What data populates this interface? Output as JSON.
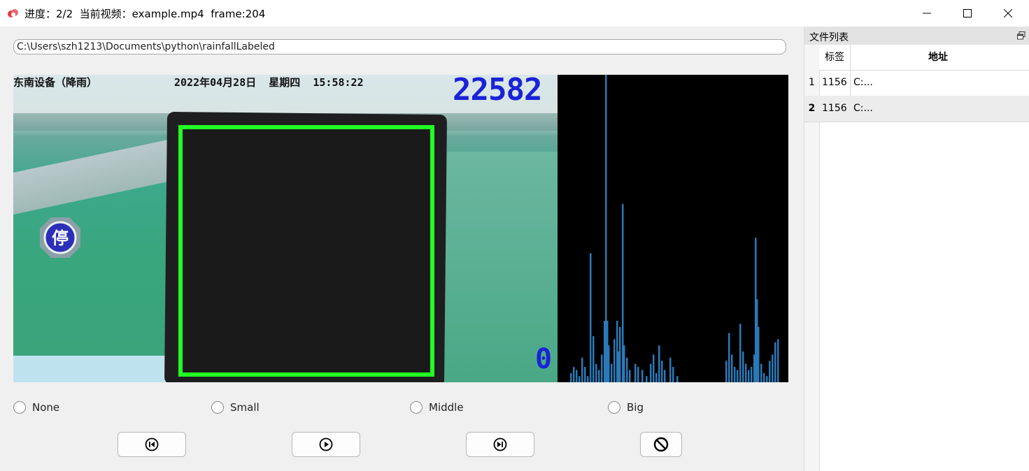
{
  "window": {
    "title": "进度：2/2  当前视频：example.mp4  frame:204",
    "minimize_icon": "minimize-icon",
    "maximize_icon": "maximize-icon",
    "close_icon": "close-icon"
  },
  "path_field": {
    "value": "C:\\Users\\szh1213\\Documents\\python\\rainfallLabeled"
  },
  "video": {
    "overlay_device": "东南设备（降雨）",
    "overlay_datetime": "2022年04月28日  星期四  15:58:22",
    "counter": "22582",
    "bottom_counter": "0",
    "badge_char": "停",
    "box_color": "#22ff22"
  },
  "spectrum": {
    "bar_color": "#2a7ab8",
    "bars": [
      [
        18,
        0.03
      ],
      [
        22,
        0.05
      ],
      [
        26,
        0.04
      ],
      [
        30,
        0.02
      ],
      [
        34,
        0.08
      ],
      [
        38,
        0.05
      ],
      [
        42,
        0.02
      ],
      [
        46,
        0.42
      ],
      [
        50,
        0.15
      ],
      [
        54,
        0.06
      ],
      [
        58,
        0.04
      ],
      [
        62,
        0.09
      ],
      [
        66,
        0.2
      ],
      [
        68,
        1.0
      ],
      [
        70,
        0.2
      ],
      [
        72,
        0.12
      ],
      [
        76,
        0.06
      ],
      [
        80,
        0.14
      ],
      [
        84,
        0.2
      ],
      [
        86,
        0.1
      ],
      [
        88,
        0.18
      ],
      [
        92,
        0.58
      ],
      [
        94,
        0.12
      ],
      [
        98,
        0.08
      ],
      [
        102,
        0.04
      ],
      [
        110,
        0.06
      ],
      [
        114,
        0.05
      ],
      [
        120,
        0.04
      ],
      [
        126,
        0.02
      ],
      [
        132,
        0.06
      ],
      [
        136,
        0.09
      ],
      [
        140,
        0.03
      ],
      [
        144,
        0.12
      ],
      [
        148,
        0.07
      ],
      [
        152,
        0.04
      ],
      [
        160,
        0.08
      ],
      [
        164,
        0.05
      ],
      [
        170,
        0.02
      ],
      [
        240,
        0.07
      ],
      [
        244,
        0.16
      ],
      [
        248,
        0.09
      ],
      [
        252,
        0.05
      ],
      [
        256,
        0.04
      ],
      [
        260,
        0.19
      ],
      [
        264,
        0.1
      ],
      [
        268,
        0.06
      ],
      [
        272,
        0.04
      ],
      [
        276,
        0.05
      ],
      [
        280,
        0.09
      ],
      [
        282,
        0.47
      ],
      [
        284,
        0.27
      ],
      [
        286,
        0.18
      ],
      [
        290,
        0.06
      ],
      [
        294,
        0.03
      ],
      [
        298,
        0.02
      ],
      [
        302,
        0.07
      ],
      [
        306,
        0.09
      ],
      [
        310,
        0.13
      ],
      [
        314,
        0.14
      ]
    ]
  },
  "radios": [
    {
      "label": "None"
    },
    {
      "label": "Small"
    },
    {
      "label": "Middle"
    },
    {
      "label": "Big"
    }
  ],
  "controls": {
    "prev_icon": "skip-previous-icon",
    "play_icon": "play-icon",
    "next_icon": "skip-next-icon",
    "stop_icon": "prohibit-icon"
  },
  "file_list": {
    "title": "文件列表",
    "columns": [
      "标签",
      "地址"
    ],
    "rows": [
      {
        "index": "1",
        "label": "1156",
        "address": "C:..."
      },
      {
        "index": "2",
        "label": "1156",
        "address": "C:..."
      }
    ]
  }
}
